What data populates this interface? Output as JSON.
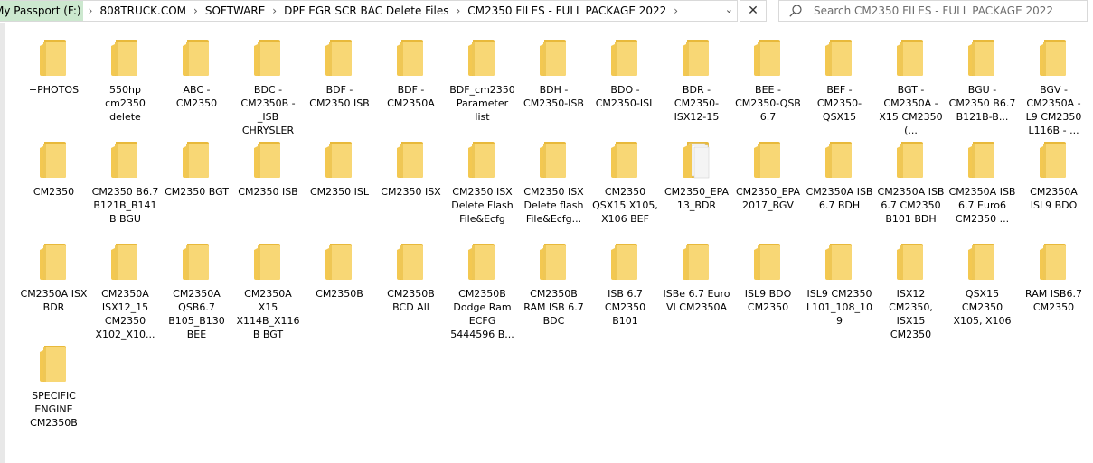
{
  "address_bar": {
    "crumbs": [
      "My Passport (F:)",
      "808TRUCK.COM",
      "SOFTWARE",
      "DPF EGR SCR BAC Delete Files",
      "CM2350 FILES - FULL PACKAGE 2022"
    ],
    "dropdown": "⌄",
    "close": "✕"
  },
  "search": {
    "placeholder": "Search CM2350 FILES - FULL PACKAGE 2022"
  },
  "items": [
    {
      "label": "+PHOTOS",
      "icon": "folder-icon"
    },
    {
      "label": "550hp cm2350 delete",
      "icon": "folder-icon"
    },
    {
      "label": "ABC - CM2350",
      "icon": "folder-icon"
    },
    {
      "label": "BDC - CM2350B -_ISB CHRYSLER",
      "icon": "folder-icon"
    },
    {
      "label": "BDF - CM2350 ISB",
      "icon": "folder-icon"
    },
    {
      "label": "BDF - CM2350A",
      "icon": "folder-icon"
    },
    {
      "label": "BDF_cm2350 Parameter list",
      "icon": "folder-icon"
    },
    {
      "label": "BDH - CM2350-ISB",
      "icon": "folder-icon"
    },
    {
      "label": "BDO - CM2350-ISL",
      "icon": "folder-icon"
    },
    {
      "label": "BDR - CM2350-ISX12-15",
      "icon": "folder-icon"
    },
    {
      "label": "BEE - CM2350-QSB 6.7",
      "icon": "folder-icon"
    },
    {
      "label": "BEF - CM2350-QSX15",
      "icon": "folder-icon"
    },
    {
      "label": "BGT - CM2350A - X15 CM2350 (...",
      "icon": "folder-icon"
    },
    {
      "label": "BGU - CM2350 B6.7 B121B-B...",
      "icon": "folder-icon"
    },
    {
      "label": "BGV - CM2350A - L9 CM2350 L116B - ...",
      "icon": "folder-icon"
    },
    {
      "label": "CM2350",
      "icon": "folder-icon"
    },
    {
      "label": "CM2350 B6.7 B121B_B141B BGU",
      "icon": "folder-icon"
    },
    {
      "label": "CM2350 BGT",
      "icon": "folder-icon"
    },
    {
      "label": "CM2350 ISB",
      "icon": "folder-icon"
    },
    {
      "label": "CM2350 ISL",
      "icon": "folder-icon"
    },
    {
      "label": "CM2350 ISX",
      "icon": "folder-icon"
    },
    {
      "label": "CM2350 ISX Delete Flash File&Ecfg",
      "icon": "folder-icon"
    },
    {
      "label": "CM2350 ISX Delete flash File&Ecfg...",
      "icon": "folder-icon"
    },
    {
      "label": "CM2350 QSX15 X105, X106 BEF",
      "icon": "folder-icon"
    },
    {
      "label": "CM2350_EPA13_BDR",
      "icon": "folder-papers-icon"
    },
    {
      "label": "CM2350_EPA2017_BGV",
      "icon": "folder-icon"
    },
    {
      "label": "CM2350A ISB 6.7 BDH",
      "icon": "folder-icon"
    },
    {
      "label": "CM2350A ISB 6.7 CM2350 B101 BDH",
      "icon": "folder-icon"
    },
    {
      "label": "CM2350A ISB 6.7 Euro6 CM2350 ...",
      "icon": "folder-icon"
    },
    {
      "label": "CM2350A ISL9 BDO",
      "icon": "folder-icon"
    },
    {
      "label": "CM2350A ISX BDR",
      "icon": "folder-icon"
    },
    {
      "label": "CM2350A ISX12_15 CM2350 X102_X10...",
      "icon": "folder-icon"
    },
    {
      "label": "CM2350A QSB6.7 B105_B130 BEE",
      "icon": "folder-icon"
    },
    {
      "label": "CM2350A X15 X114B_X116B BGT",
      "icon": "folder-icon"
    },
    {
      "label": "CM2350B",
      "icon": "folder-icon"
    },
    {
      "label": "CM2350B BCD All",
      "icon": "folder-icon"
    },
    {
      "label": "CM2350B Dodge Ram ECFG 5444596 B...",
      "icon": "folder-icon"
    },
    {
      "label": "CM2350B RAM ISB 6.7 BDC",
      "icon": "folder-icon"
    },
    {
      "label": "ISB 6.7 CM2350 B101",
      "icon": "folder-icon"
    },
    {
      "label": "ISBe 6.7 Euro VI CM2350A",
      "icon": "folder-icon"
    },
    {
      "label": "ISL9 BDO CM2350",
      "icon": "folder-icon"
    },
    {
      "label": "ISL9 CM2350 L101_108_109",
      "icon": "folder-icon"
    },
    {
      "label": "ISX12 CM2350, ISX15 CM2350",
      "icon": "folder-icon"
    },
    {
      "label": "QSX15 CM2350 X105, X106",
      "icon": "folder-icon"
    },
    {
      "label": "RAM ISB6.7 CM2350",
      "icon": "folder-icon"
    },
    {
      "label": "SPECIFIC ENGINE CM2350B",
      "icon": "folder-icon"
    }
  ],
  "colors": {
    "folder_back": "#e8b93b",
    "folder_front": "#f8d775",
    "folder_front_shade": "#f3c851",
    "highlight": "#cce8cf"
  }
}
